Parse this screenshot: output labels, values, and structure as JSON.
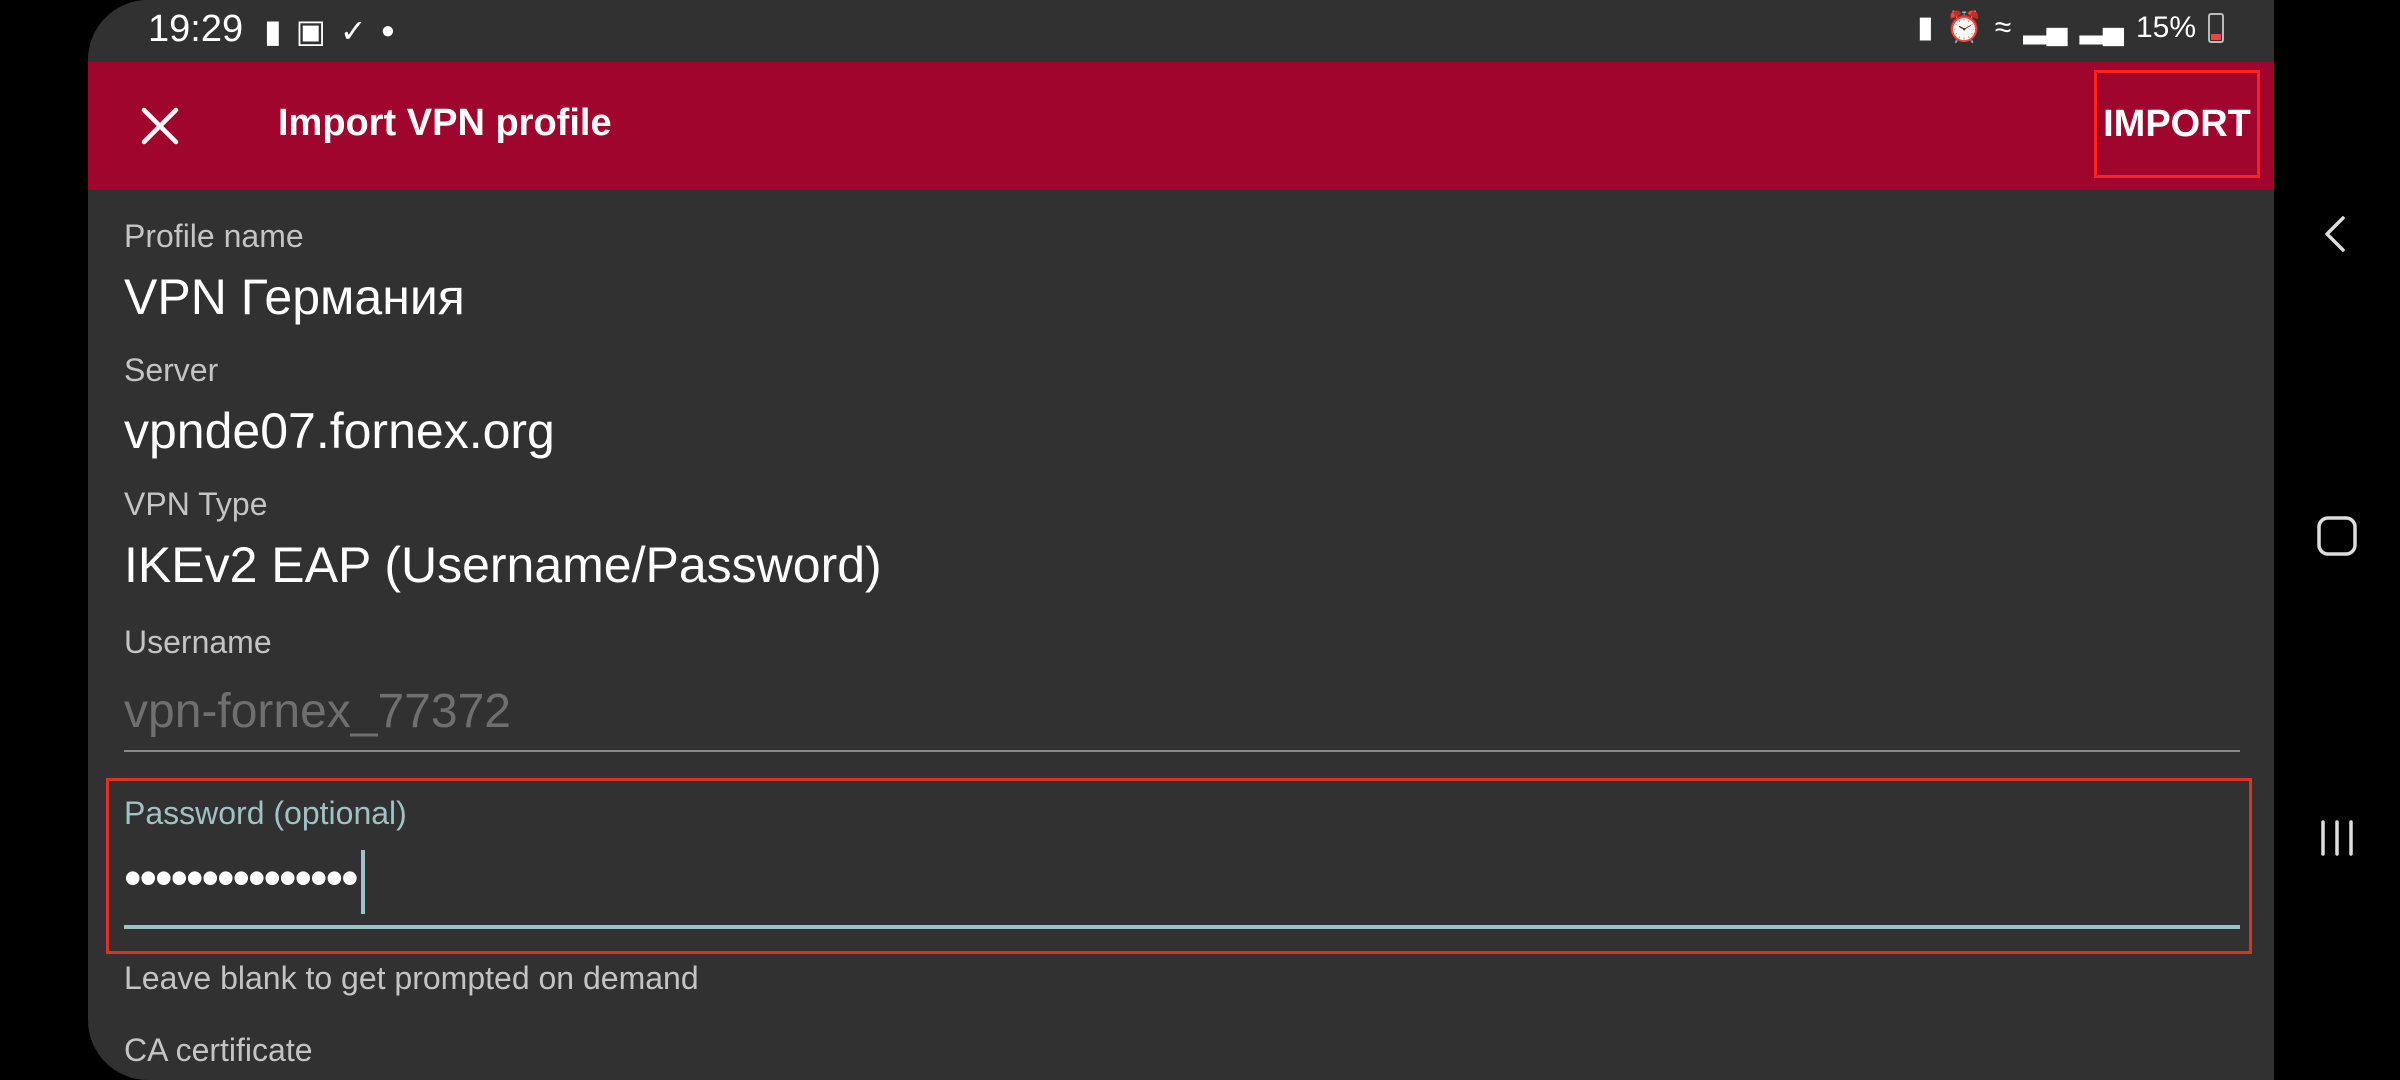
{
  "status_bar": {
    "time": "19:29",
    "left_icons": [
      "alert-icon",
      "image-icon",
      "check-icon",
      "dot-icon"
    ],
    "right_icons": [
      "battery-saver-icon",
      "alarm-icon",
      "wifi-icon",
      "signal-icon",
      "signal-roaming-icon"
    ],
    "battery_percent": "15%"
  },
  "app_bar": {
    "title": "Import VPN profile",
    "action_label": "IMPORT",
    "background": "#a0052d"
  },
  "form": {
    "profile_name": {
      "label": "Profile name",
      "value": "VPN Германия"
    },
    "server": {
      "label": "Server",
      "value": "vpnde07.fornex.org"
    },
    "vpn_type": {
      "label": "VPN Type",
      "value": "IKEv2 EAP (Username/Password)"
    },
    "username": {
      "label": "Username",
      "placeholder": "vpn-fornex_77372"
    },
    "password": {
      "label": "Password (optional)",
      "masked_value": "•••••••••••••••",
      "hint": "Leave blank to get prompted on demand"
    },
    "ca_certificate": {
      "label": "CA certificate"
    }
  },
  "nav_bar": {
    "buttons": [
      "back-icon",
      "home-icon",
      "recents-icon"
    ]
  }
}
